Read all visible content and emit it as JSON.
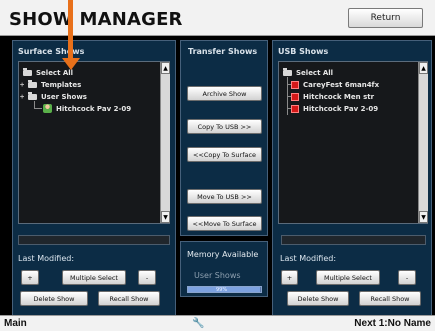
{
  "title": "SHOW MANAGER",
  "return_label": "Return",
  "surface_panel": {
    "label": "Surface Shows",
    "items": [
      {
        "label": "Select All",
        "icon": "folder-icon"
      },
      {
        "label": "Templates",
        "icon": "folder-icon"
      },
      {
        "label": "User Shows",
        "icon": "folder-icon"
      },
      {
        "label": "Hitchcock Pav 2-09",
        "icon": "user-show-icon"
      }
    ],
    "last_modified_label": "Last Modified:",
    "add_label": "+",
    "multi_select_label": "Multiple Select",
    "remove_label": "-",
    "delete_label": "Delete Show",
    "recall_label": "Recall Show"
  },
  "transfer_panel": {
    "label": "Transfer Shows",
    "archive_label": "Archive Show",
    "copy_to_usb_label": "Copy To USB >>",
    "copy_to_surface_label": "<<Copy To Surface",
    "move_to_usb_label": "Move To USB >>",
    "move_to_surface_label": "<<Move To Surface",
    "memory_label": "Memory Available",
    "memory_type_label": "User Shows",
    "memory_percent_label": "99%",
    "memory_fraction": 0.99
  },
  "usb_panel": {
    "label": "USB Shows",
    "items": [
      {
        "label": "Select All",
        "icon": "folder-icon"
      },
      {
        "label": "CareyFest 6man4fx",
        "icon": "red-show-icon"
      },
      {
        "label": "Hitchcock Men str",
        "icon": "red-show-icon"
      },
      {
        "label": "Hitchcock Pav 2-09",
        "icon": "red-show-icon"
      }
    ],
    "last_modified_label": "Last Modified:",
    "add_label": "+",
    "multi_select_label": "Multiple Select",
    "remove_label": "-",
    "delete_label": "Delete Show",
    "recall_label": "Recall Show"
  },
  "footer": {
    "left": "Main",
    "right": "Next 1:No Name",
    "center_icon": "screwdriver-icon"
  },
  "colors": {
    "accent_arrow": "#e8701a",
    "panel_bg": "#0c2c45",
    "red_icon": "#d41818"
  }
}
